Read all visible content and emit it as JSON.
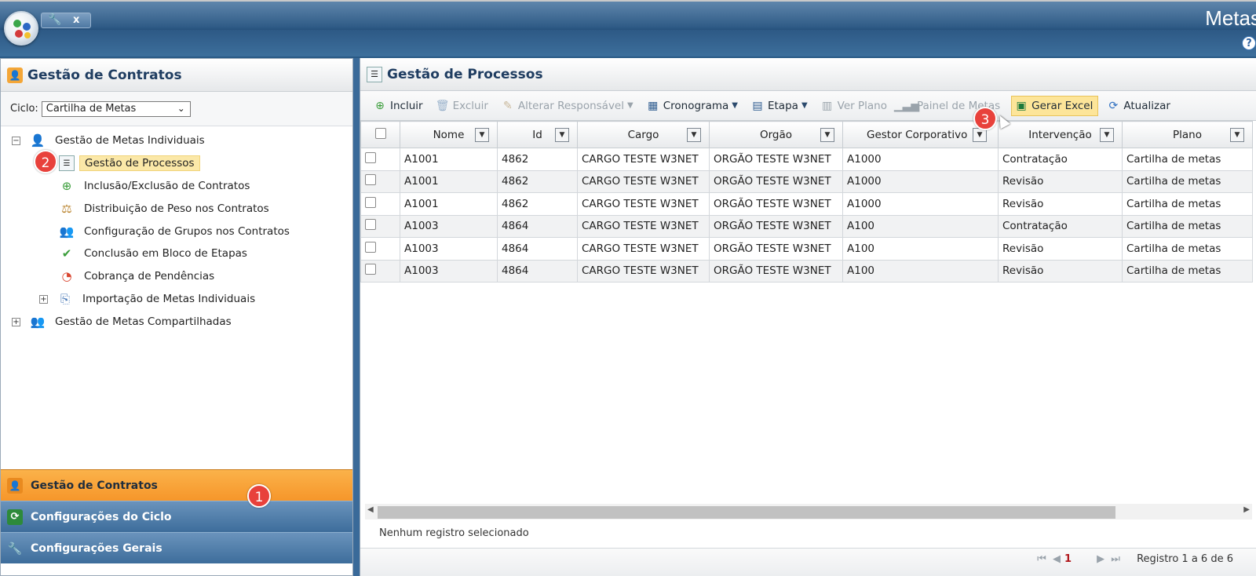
{
  "app": {
    "title": "Metas",
    "help_symbol": "?",
    "close_symbol": "x"
  },
  "left_panel": {
    "title": "Gestão de Contratos",
    "cycle_label": "Ciclo:",
    "cycle_value": "Cartilha de Metas",
    "tree": [
      {
        "label": "Gestão de Metas Individuais",
        "expander": "−"
      },
      {
        "label": "Gestão de Processos"
      },
      {
        "label": "Inclusão/Exclusão de Contratos"
      },
      {
        "label": "Distribuição de Peso nos Contratos"
      },
      {
        "label": "Configuração de Grupos nos Contratos"
      },
      {
        "label": "Conclusão em Bloco de Etapas"
      },
      {
        "label": "Cobrança de Pendências"
      },
      {
        "label": "Importação de Metas Individuais",
        "expander": "+"
      },
      {
        "label": "Gestão de Metas Compartilhadas",
        "expander": "+"
      }
    ],
    "accordion": [
      {
        "label": "Gestão de Contratos"
      },
      {
        "label": "Configurações do Ciclo"
      },
      {
        "label": "Configurações Gerais"
      }
    ]
  },
  "badges": {
    "one": "1",
    "two": "2",
    "three": "3"
  },
  "right_panel": {
    "title": "Gestão de Processos",
    "toolbar": {
      "incluir": "Incluir",
      "excluir": "Excluir",
      "alterar": "Alterar Responsável",
      "cronograma": "Cronograma",
      "etapa": "Etapa",
      "ver_plano": "Ver Plano",
      "painel": "Painel de Metas",
      "gerar_excel": "Gerar Excel",
      "atualizar": "Atualizar"
    },
    "columns": [
      "Nome",
      "Id",
      "Cargo",
      "Orgão",
      "Gestor Corporativo",
      "Intervenção",
      "Plano"
    ],
    "rows": [
      [
        "A1001",
        "4862",
        "CARGO TESTE W3NET",
        "ORGÃO TESTE W3NET",
        "A1000",
        "Contratação",
        "Cartilha de metas"
      ],
      [
        "A1001",
        "4862",
        "CARGO TESTE W3NET",
        "ORGÃO TESTE W3NET",
        "A1000",
        "Revisão",
        "Cartilha de metas"
      ],
      [
        "A1001",
        "4862",
        "CARGO TESTE W3NET",
        "ORGÃO TESTE W3NET",
        "A1000",
        "Revisão",
        "Cartilha de metas"
      ],
      [
        "A1003",
        "4864",
        "CARGO TESTE W3NET",
        "ORGÃO TESTE W3NET",
        "A100",
        "Contratação",
        "Cartilha de metas"
      ],
      [
        "A1003",
        "4864",
        "CARGO TESTE W3NET",
        "ORGÃO TESTE W3NET",
        "A100",
        "Revisão",
        "Cartilha de metas"
      ],
      [
        "A1003",
        "4864",
        "CARGO TESTE W3NET",
        "ORGÃO TESTE W3NET",
        "A100",
        "Revisão",
        "Cartilha de metas"
      ]
    ],
    "status": "Nenhum registro selecionado",
    "pager": {
      "page": "1",
      "info": "Registro 1 a 6 de 6"
    }
  },
  "colors": {
    "accent_orange": "#f6962a",
    "header_blue": "#2f5b86",
    "badge_red": "#e8413b",
    "highlight_yellow": "#fde599"
  }
}
